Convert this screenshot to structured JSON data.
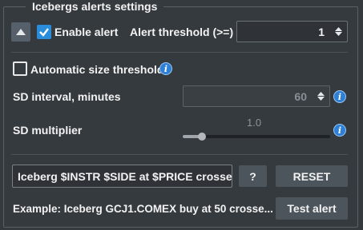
{
  "group": {
    "title": "Icebergs alerts settings"
  },
  "enable_alert": {
    "label": "Enable alert",
    "checked": true
  },
  "alert_threshold": {
    "label": "Alert threshold (>=)",
    "value": "1"
  },
  "auto_size": {
    "label": "Automatic size threshold",
    "checked": false,
    "info": "i"
  },
  "sd_interval": {
    "label": "SD interval, minutes",
    "value": "60",
    "info": "i"
  },
  "sd_multiplier": {
    "label": "SD multiplier",
    "value_text": "1.0",
    "fraction": 0.13,
    "info": "i"
  },
  "message": {
    "template": "Iceberg $INSTR $SIDE at $PRICE crossed",
    "help_label": "?",
    "reset_label": "RESET"
  },
  "example": {
    "text": "Example: Iceberg GCJ1.COMEX buy at 50 crosse...",
    "test_label": "Test alert"
  },
  "colors": {
    "accent": "#2a8ddb",
    "background": "#353a3f",
    "button": "#4c545c"
  }
}
